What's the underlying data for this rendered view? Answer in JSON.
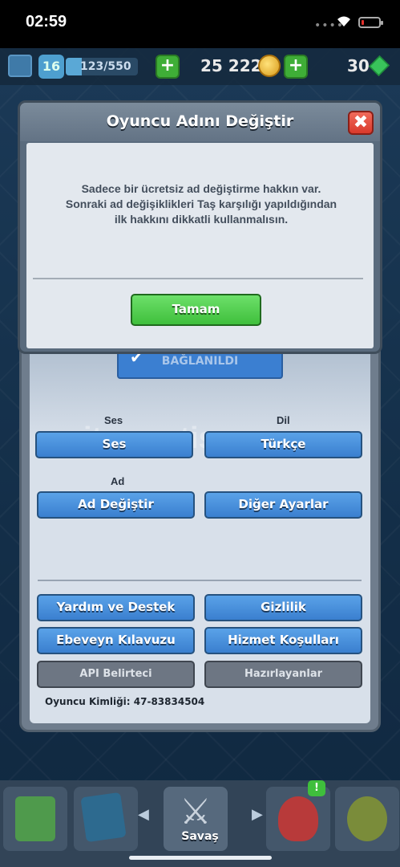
{
  "status_bar": {
    "time": "02:59",
    "signal_dots": "••••",
    "battery_level": 0.1
  },
  "top_bar": {
    "level": "16",
    "xp": "123/550",
    "xp_fraction": 0.22,
    "gold": "25 222",
    "gems": "30",
    "plus": "+"
  },
  "dialog": {
    "title": "Oyuncu Adını Değiştir",
    "close_glyph": "✖",
    "message": "Sadece bir ücretsiz ad değiştirme hakkın var. Sonraki ad değişiklikleri Taş karşılığı yapıldığından ilk hakkını dikkatli kullanmalısın.",
    "ok_label": "Tamam"
  },
  "settings": {
    "connected_label": "BAĞLANILDI",
    "sound_label": "Ses",
    "sound_button": "Ses",
    "language_label": "Dil",
    "language_button": "Türkçe",
    "name_label": "Ad",
    "change_name_button": "Ad Değiştir",
    "other_settings_button": "Diğer Ayarlar",
    "help_button": "Yardım ve Destek",
    "privacy_button": "Gizlilik",
    "parents_guide_button": "Ebeveyn Kılavuzu",
    "terms_button": "Hizmet Koşulları",
    "api_token_button": "API Belirteci",
    "credits_button": "Hazırlayanlar",
    "player_id": "Oyuncu Kimliği: 47-83834504",
    "watermark": "itemsatis"
  },
  "bottom_nav": {
    "battle_label": "Savaş",
    "badge": "!",
    "left_arrow": "◀",
    "right_arrow": "▶"
  },
  "colors": {
    "accent_green": "#3fbf3c",
    "button_blue": "#3a7fcf",
    "close_red": "#d93a2c"
  }
}
